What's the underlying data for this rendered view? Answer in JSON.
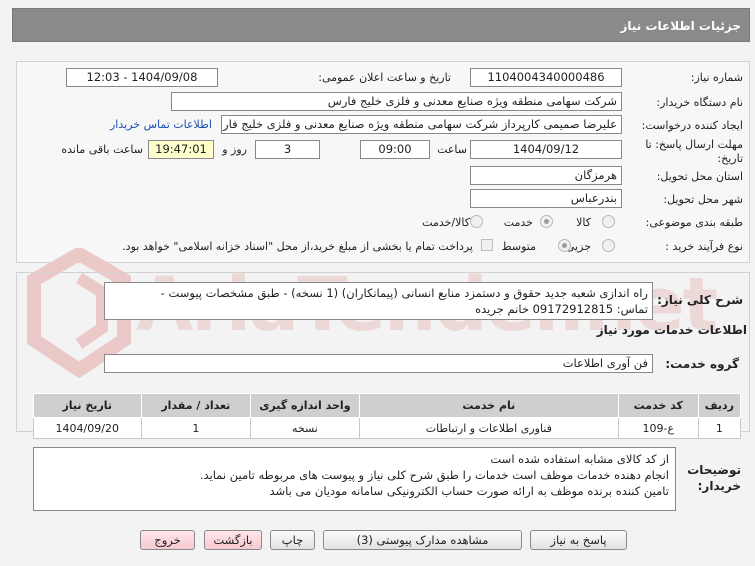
{
  "header": {
    "title": "جزئیات اطلاعات نیاز"
  },
  "watermark": {
    "text": "AriaTender.net"
  },
  "fields": {
    "need_number": {
      "label": "شماره نیاز:",
      "value": "1104004340000486"
    },
    "announce": {
      "label": "تاریخ و ساعت اعلان عمومی:",
      "value": "1404/09/08 - 12:03"
    },
    "buyer_org": {
      "label": "نام دستگاه خریدار:",
      "value": "شرکت سهامی منطقه ویژه صنایع معدنی و فلزی خلیج فارس"
    },
    "requester": {
      "label": "ایجاد کننده درخواست:",
      "value": "علیرضا صمیمی کارپرداز شرکت سهامی منطقه ویژه صنایع معدنی و فلزی خلیج فارس"
    },
    "buyer_contact_link": "اطلاعات تماس خریدار",
    "deadline": {
      "label": "مهلت ارسال پاسخ: تا تاریخ:",
      "date": "1404/09/12",
      "time_label": "ساعت",
      "time": "09:00",
      "days": "3",
      "days_label": "روز و",
      "remaining": "19:47:01",
      "remaining_label": "ساعت باقی مانده"
    },
    "province": {
      "label": "استان محل تحویل:",
      "value": "هرمزگان"
    },
    "city": {
      "label": "شهر محل تحویل:",
      "value": "بندرعباس"
    },
    "category": {
      "label": "طبقه بندی موضوعی:",
      "options": [
        "کالا",
        "خدمت",
        "کالا/خدمت"
      ],
      "selected": "خدمت"
    },
    "process": {
      "label": "نوع فرآیند خرید :",
      "options": [
        "جزیی",
        "متوسط"
      ],
      "selected": "متوسط",
      "payment_note": "پرداخت تمام یا بخشی از مبلغ خرید،از محل \"اسناد خزانه اسلامی\" خواهد بود."
    }
  },
  "summary": {
    "label": "شرح کلی نیاز:",
    "line1": "راه اندازی شعبه جدید حقوق و دستمزد منابع انسانی (پیمانکاران) (1 نسخه) - طبق مشخصات پیوست -",
    "line2": "تماس: 09172912815 خانم جریده"
  },
  "services_title": "اطلاعات خدمات مورد نیاز",
  "service_group": {
    "label": "گروه خدمت:",
    "value": "فن آوری اطلاعات"
  },
  "table": {
    "headers": [
      "ردیف",
      "کد خدمت",
      "نام خدمت",
      "واحد اندازه گیری",
      "تعداد / مقدار",
      "تاریخ نیاز"
    ],
    "rows": [
      [
        "1",
        "ع-109",
        "فناوری اطلاعات و ارتباطات",
        "نسخه",
        "1",
        "1404/09/20"
      ]
    ]
  },
  "buyer_notes": {
    "label": "توضیحات خریدار:",
    "lines": [
      "از کد کالای مشابه استفاده شده است",
      "انجام دهنده خدمات موظف است خدمات را طبق شرح کلی نیاز و پیوست های مربوطه تامین نماید.",
      "تامین کننده برنده موظف به ارائه صورت حساب الکترونیکی سامانه مودیان می باشد"
    ]
  },
  "buttons": {
    "reply": "پاسخ به نیاز",
    "attachments": "مشاهده مدارک پیوستی (3)",
    "print": "چاپ",
    "back": "بازگشت",
    "exit": "خروج"
  },
  "colors": {
    "header_bg": "#8a8a8a",
    "link": "#1f4fb3",
    "time_bg": "#ffffcc",
    "watermark": "#e9c2c2"
  }
}
